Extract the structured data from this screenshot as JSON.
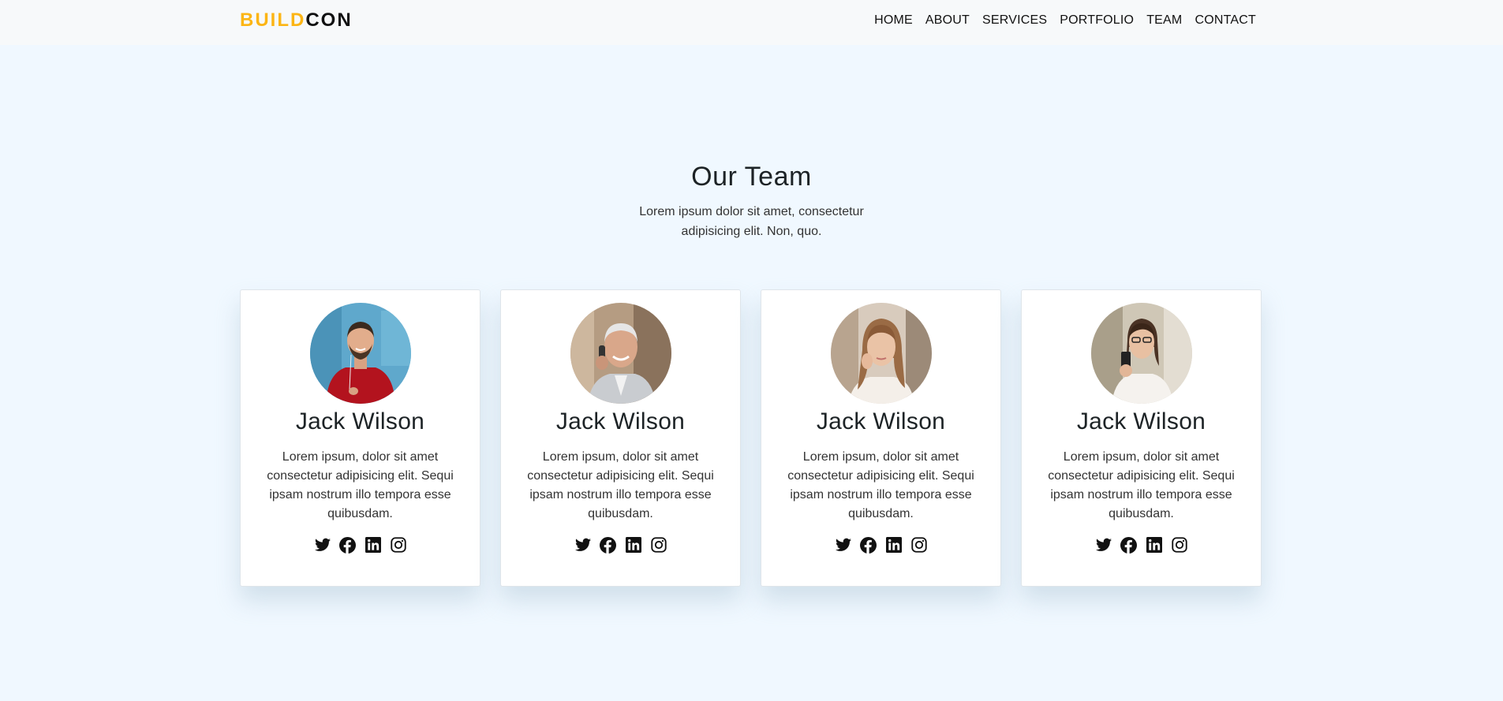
{
  "brand": {
    "part1": "BUILD",
    "part2": "CON",
    "color1": "#fcb514",
    "color2": "#111111"
  },
  "nav": [
    "HOME",
    "ABOUT",
    "SERVICES",
    "PORTFOLIO",
    "TEAM",
    "CONTACT"
  ],
  "team": {
    "title": "Our Team",
    "subtitle": "Lorem ipsum dolor sit amet, consectetur adipisicing elit. Non, quo.",
    "members": [
      {
        "name": "Jack Wilson",
        "text": "Lorem ipsum, dolor sit amet consectetur adipisicing elit. Sequi ipsam nostrum illo tempora esse quibusdam.",
        "photo": "man in red shirt with earphones"
      },
      {
        "name": "Jack Wilson",
        "text": "Lorem ipsum, dolor sit amet consectetur adipisicing elit. Sequi ipsam nostrum illo tempora esse quibusdam.",
        "photo": "older man on phone"
      },
      {
        "name": "Jack Wilson",
        "text": "Lorem ipsum, dolor sit amet consectetur adipisicing elit. Sequi ipsam nostrum illo tempora esse quibusdam.",
        "photo": "woman on phone"
      },
      {
        "name": "Jack Wilson",
        "text": "Lorem ipsum, dolor sit amet consectetur adipisicing elit. Sequi ipsam nostrum illo tempora esse quibusdam.",
        "photo": "woman with glasses holding phone"
      }
    ],
    "social_icons": [
      "twitter-icon",
      "facebook-icon",
      "linkedin-icon",
      "instagram-icon"
    ]
  }
}
